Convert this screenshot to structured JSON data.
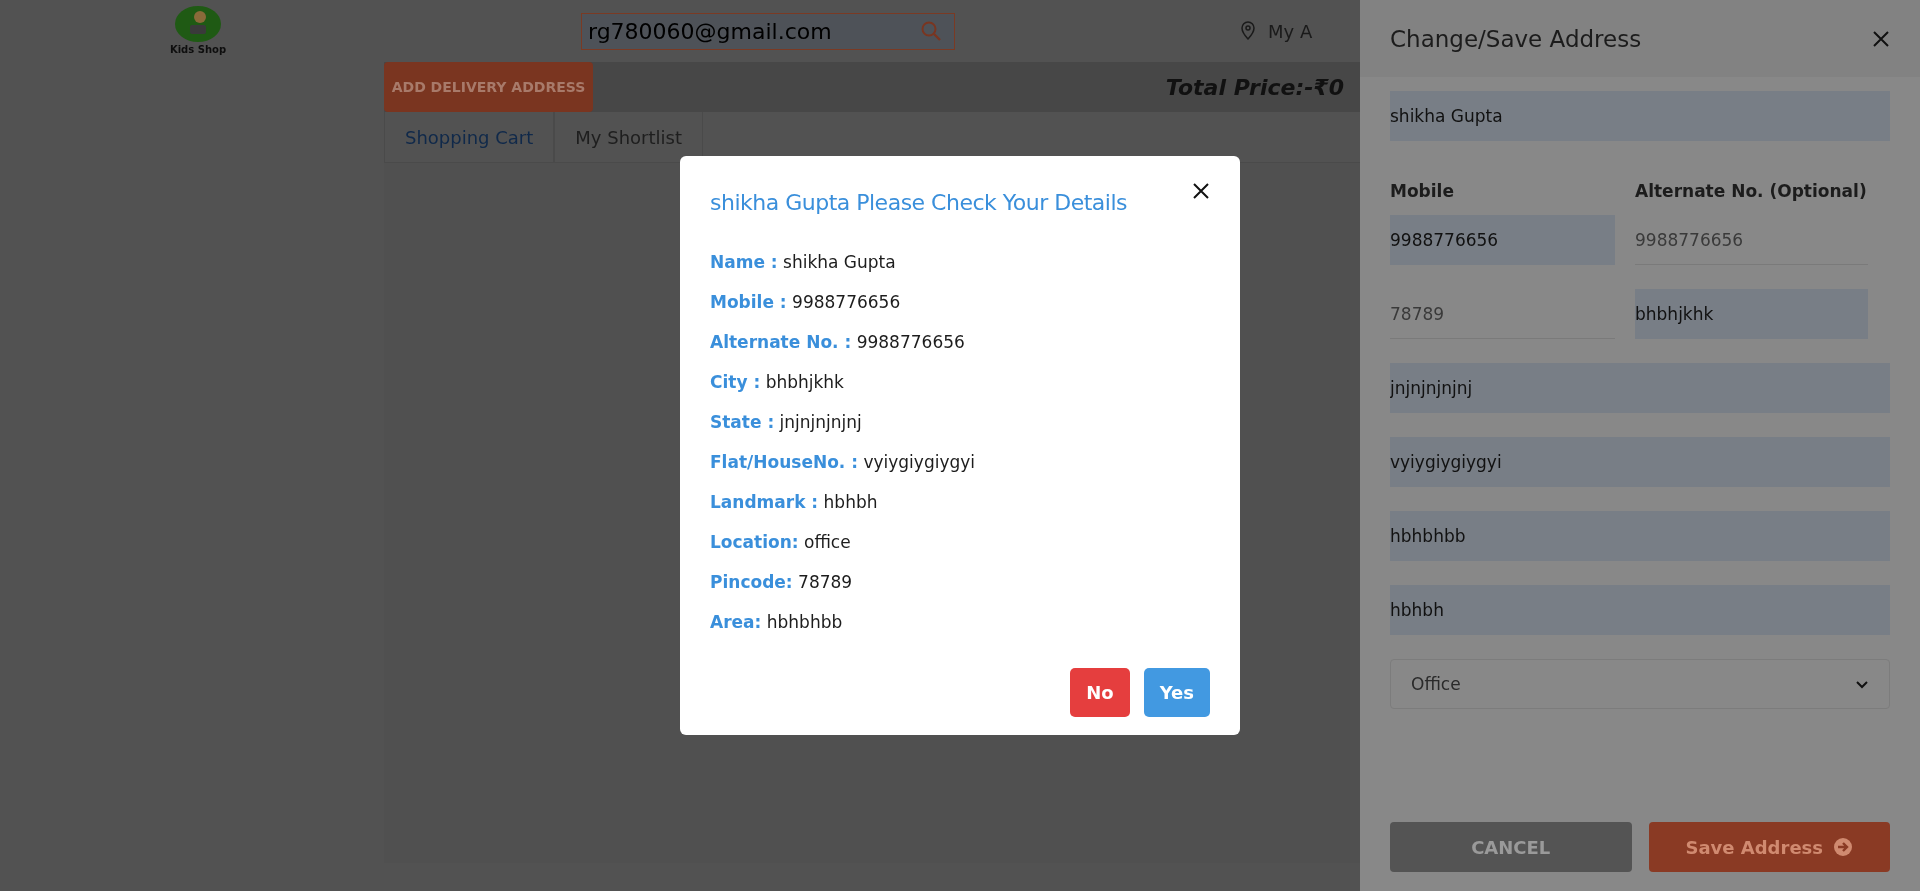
{
  "header": {
    "logo_text": "Kids Shop",
    "search": {
      "value": "rg780060@gmail.com"
    },
    "account_label": "My A"
  },
  "toolbar": {
    "add_button": "ADD DELIVERY ADDRESS",
    "total": "Total Price:-₹0"
  },
  "tabs": [
    {
      "label": "Shopping Cart",
      "selected": true
    },
    {
      "label": "My Shortlist",
      "selected": false
    }
  ],
  "modal": {
    "title": "shikha Gupta Please Check Your Details",
    "details": [
      {
        "label": "Name :",
        "value": "shikha Gupta"
      },
      {
        "label": "Mobile :",
        "value": "9988776656"
      },
      {
        "label": "Alternate No. :",
        "value": "9988776656"
      },
      {
        "label": "City :",
        "value": "bhbhjkhk"
      },
      {
        "label": "State :",
        "value": "jnjnjnjnjnj"
      },
      {
        "label": "Flat/HouseNo. :",
        "value": "vyiygiygiygyi"
      },
      {
        "label": "Landmark :",
        "value": "hbhbh"
      },
      {
        "label": "Location:",
        "value": "office"
      },
      {
        "label": "Pincode:",
        "value": "78789"
      },
      {
        "label": "Area:",
        "value": "hbhbhbb"
      }
    ],
    "buttons": [
      {
        "label": "No",
        "kind": "danger"
      },
      {
        "label": "Yes",
        "kind": "primary"
      }
    ]
  },
  "drawer": {
    "title": "Change/Save Address",
    "rows": [
      [
        {
          "kind": "filled",
          "value": "shikha Gupta"
        }
      ],
      [
        {
          "kind": "filled",
          "label": "Mobile",
          "value": "9988776656"
        },
        {
          "kind": "underline",
          "label": "Alternate No. (Optional)",
          "value": "9988776656"
        }
      ],
      [
        {
          "kind": "underline",
          "value": "78789"
        },
        {
          "kind": "filled",
          "value": "bhbhjkhk"
        }
      ],
      [
        {
          "kind": "filled",
          "value": "jnjnjnjnjnj"
        }
      ],
      [
        {
          "kind": "filled",
          "value": "vyiygiygiygyi"
        }
      ],
      [
        {
          "kind": "filled",
          "value": "hbhbhbb"
        }
      ],
      [
        {
          "kind": "filled",
          "value": "hbhbh"
        }
      ],
      [
        {
          "kind": "select",
          "value": "Office"
        }
      ]
    ],
    "buttons": [
      {
        "label": "CANCEL",
        "kind": "cancel"
      },
      {
        "label": "Save Address",
        "kind": "save"
      }
    ]
  }
}
